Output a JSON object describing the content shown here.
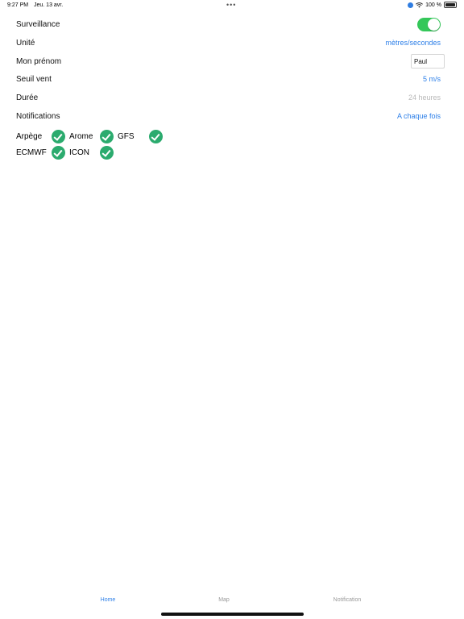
{
  "status_bar": {
    "time": "9:27 PM",
    "date": "Jeu. 13 avr.",
    "dots": "•••",
    "battery": "100 %"
  },
  "settings": {
    "surveillance": {
      "label": "Surveillance",
      "enabled": true
    },
    "unit": {
      "label": "Unité",
      "value": "mètres/secondes"
    },
    "first_name": {
      "label": "Mon prénom",
      "value": "Paul"
    },
    "wind_threshold": {
      "label": "Seuil vent",
      "value": "5 m/s"
    },
    "duration": {
      "label": "Durée",
      "value": "24 heures"
    },
    "notifications": {
      "label": "Notifications",
      "value": "A chaque fois"
    }
  },
  "models": [
    {
      "label": "Arpège",
      "checked": true
    },
    {
      "label": "Arome",
      "checked": true
    },
    {
      "label": "GFS",
      "checked": true
    },
    {
      "label": "ECMWF",
      "checked": true
    },
    {
      "label": "ICON",
      "checked": true
    }
  ],
  "tabbar": {
    "home": "Home",
    "map": "Map",
    "notification": "Notification"
  },
  "colors": {
    "accent": "#2f80e8",
    "toggle_on": "#34c759",
    "check": "#2bab6e",
    "muted": "#b8b8b8"
  }
}
